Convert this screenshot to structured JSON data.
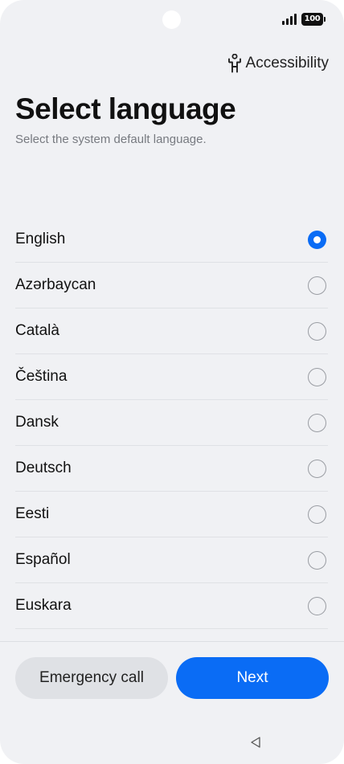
{
  "status_bar": {
    "battery_level": "100",
    "icons": [
      "signal-icon",
      "battery-icon"
    ]
  },
  "accessibility": {
    "label": "Accessibility",
    "icon": "accessibility-icon"
  },
  "header": {
    "title": "Select language",
    "subtitle": "Select the system default language."
  },
  "languages": [
    {
      "label": "English",
      "selected": true
    },
    {
      "label": "Azərbaycan",
      "selected": false
    },
    {
      "label": "Català",
      "selected": false
    },
    {
      "label": "Čeština",
      "selected": false
    },
    {
      "label": "Dansk",
      "selected": false
    },
    {
      "label": "Deutsch",
      "selected": false
    },
    {
      "label": "Eesti",
      "selected": false
    },
    {
      "label": "Español",
      "selected": false
    },
    {
      "label": "Euskara",
      "selected": false
    }
  ],
  "footer": {
    "emergency_label": "Emergency call",
    "next_label": "Next"
  },
  "nav": {
    "back_icon": "back-triangle-icon"
  },
  "colors": {
    "accent": "#0a6cf5",
    "background": "#f0f1f4",
    "secondary_button": "#dfe1e5"
  }
}
